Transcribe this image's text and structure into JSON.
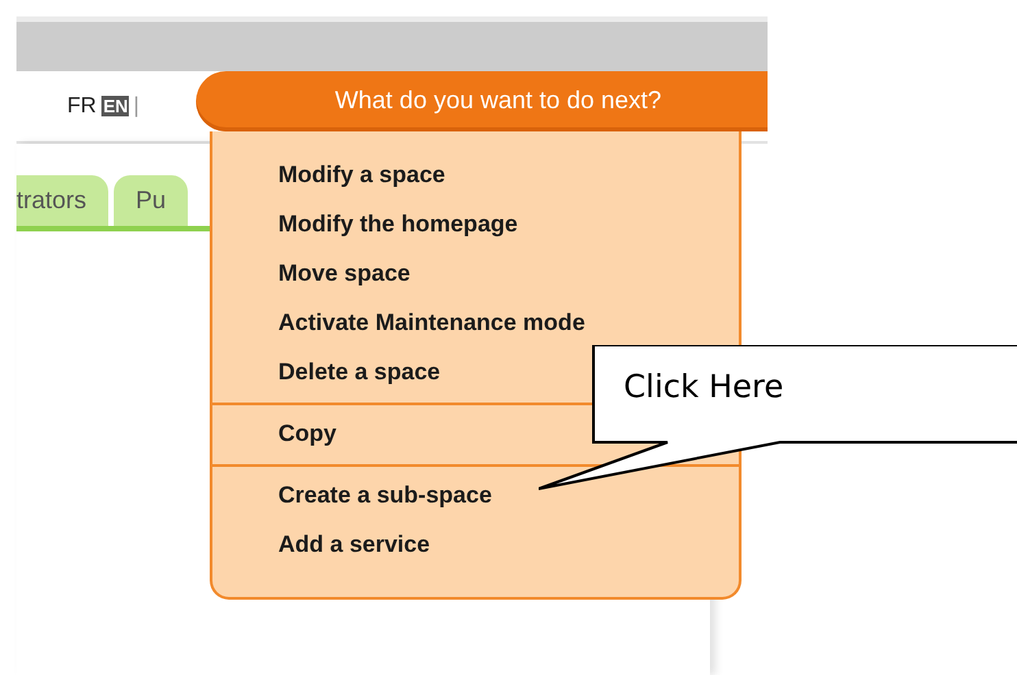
{
  "languages": [
    {
      "label": "FR",
      "selected": false
    },
    {
      "label": "EN",
      "selected": true
    }
  ],
  "language_separator": "|",
  "next_button": {
    "label": "What do you want to do next?",
    "expanded": true
  },
  "tabs": [
    {
      "label": "trators",
      "selected": false
    },
    {
      "label": "Pu",
      "selected": false
    }
  ],
  "menu": {
    "sections": [
      {
        "items": [
          "Modify a space",
          "Modify the homepage",
          "Move space",
          "Activate Maintenance mode",
          "Delete a space"
        ]
      },
      {
        "items": [
          "Copy"
        ]
      },
      {
        "items": [
          "Create a sub-space",
          "Add a service"
        ]
      }
    ]
  },
  "callout": {
    "text": "Click Here"
  }
}
